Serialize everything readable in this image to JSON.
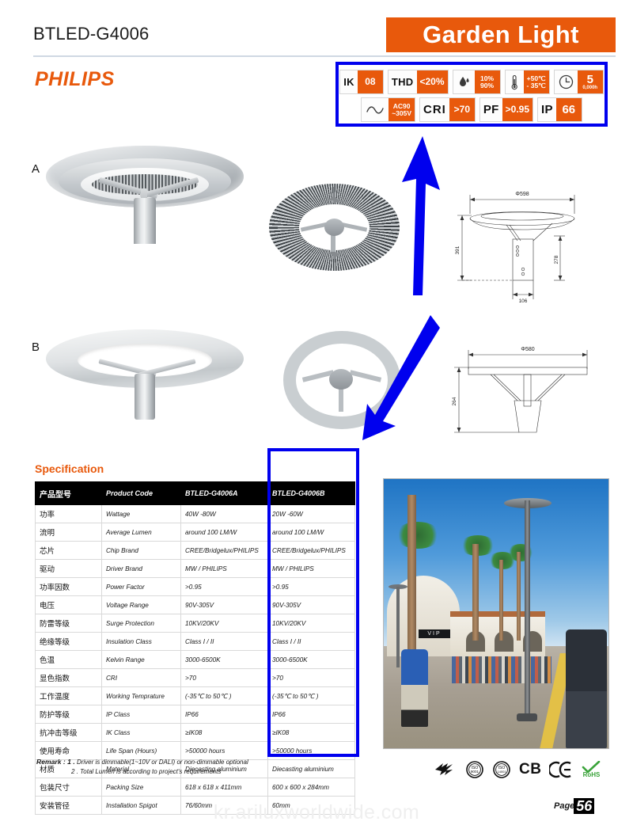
{
  "header": {
    "model_code": "BTLED-G4006",
    "title": "Garden Light",
    "brand": "PHILIPS",
    "accent_color": "#e8590c",
    "highlight_color": "#0000ee"
  },
  "badges": {
    "row1": [
      {
        "label": "IK",
        "value": "08",
        "icon": ""
      },
      {
        "label": "THD",
        "value": "<20%",
        "icon": ""
      },
      {
        "label": "",
        "value": "10%\n90%",
        "icon": "water-drop-icon",
        "value_top": "10%",
        "value_bottom": "90%"
      },
      {
        "label": "",
        "value": "+50℃\n- 35℃",
        "icon": "thermometer-icon",
        "value_top": "+50℃",
        "value_bottom": "- 35℃"
      },
      {
        "label": "",
        "value": "5",
        "icon": "clock-icon",
        "value_big": "5",
        "value_tiny": "0,000h"
      }
    ],
    "row2": [
      {
        "label": "",
        "value": "AC90\n~305V",
        "icon": "ac-wave-icon",
        "value_top": "AC90",
        "value_bottom": "~305V"
      },
      {
        "label": "CRI",
        "value": ">70",
        "icon": ""
      },
      {
        "label": "PF",
        "value": ">0.95",
        "icon": ""
      },
      {
        "label": "IP",
        "value": "66",
        "icon": ""
      }
    ]
  },
  "products": {
    "label_a": "A",
    "label_b": "B"
  },
  "drawings": {
    "a": {
      "diameter": "Φ598",
      "total_height": "391",
      "body_height": "278",
      "spigot_width": "106"
    },
    "b": {
      "diameter": "Φ580",
      "total_height": "264"
    }
  },
  "specification": {
    "heading": "Specification",
    "columns": [
      "产品型号",
      "Product Code",
      "BTLED-G4006A",
      "BTLED-G4006B"
    ],
    "rows": [
      {
        "cn": "功率",
        "en": "Wattage",
        "a": "40W -80W",
        "b": "20W -60W"
      },
      {
        "cn": "流明",
        "en": "Average Lumen",
        "a": "around 100 LM/W",
        "b": "around 100 LM/W"
      },
      {
        "cn": "芯片",
        "en": "Chip Brand",
        "a": "CREE/Bridgelux/PHILIPS",
        "b": "CREE/Bridgelux/PHILIPS"
      },
      {
        "cn": "驱动",
        "en": "Driver Brand",
        "a": "MW / PHILIPS",
        "b": "MW / PHILIPS"
      },
      {
        "cn": "功率因数",
        "en": "Power Factor",
        "a": ">0.95",
        "b": ">0.95"
      },
      {
        "cn": "电压",
        "en": "Voltage Range",
        "a": "90V-305V",
        "b": "90V-305V"
      },
      {
        "cn": "防雷等级",
        "en": "Surge Protection",
        "a": "10KV/20KV",
        "b": "10KV/20KV"
      },
      {
        "cn": "绝缘等级",
        "en": "Insulation Class",
        "a": "Class I / II",
        "b": "Class I / II"
      },
      {
        "cn": "色温",
        "en": "Kelvin Range",
        "a": "3000-6500K",
        "b": "3000-6500K"
      },
      {
        "cn": "显色指数",
        "en": "CRI",
        "a": ">70",
        "b": ">70"
      },
      {
        "cn": "工作温度",
        "en": "Working Temprature",
        "a": "(-35℃ to 50℃ )",
        "b": "(-35℃ to 50℃ )"
      },
      {
        "cn": "防护等级",
        "en": "IP Class",
        "a": "IP66",
        "b": "IP66"
      },
      {
        "cn": "抗冲击等级",
        "en": "IK  Class",
        "a": "≥IK08",
        "b": "≥IK08"
      },
      {
        "cn": "使用寿命",
        "en": "Life Span (Hours)",
        "a": ">50000 hours",
        "b": ">50000 hours"
      },
      {
        "cn": "材质",
        "en": "Material",
        "a": "Diecasting aluminium",
        "b": "Diecasting aluminium"
      },
      {
        "cn": "包装尺寸",
        "en": "Packing Size",
        "a": "618 x 618 x 411mm",
        "b": "600 x 600 x 284mm"
      },
      {
        "cn": "安装管径",
        "en": "Installation Spigot",
        "a": "76/60mm",
        "b": "60mm"
      }
    ]
  },
  "remark": {
    "title": "Remark : 1 .",
    "line1": " Driver is dimmable(1~10V or DALI) or non-dimmable optional",
    "line2": "2 . Total Lumen is according to project's requirements"
  },
  "photo": {
    "sign_text": "VIP"
  },
  "certifications": [
    {
      "name": "ccc-mark-icon",
      "text": ""
    },
    {
      "name": "iso-9001-icon",
      "text": "ISO 9001"
    },
    {
      "name": "iso-14001-icon",
      "text": "ISO 14001"
    },
    {
      "name": "cb-mark",
      "text": "CB"
    },
    {
      "name": "ce-mark",
      "text": "CE"
    },
    {
      "name": "rohs-mark",
      "text": "RoHS"
    }
  ],
  "footer": {
    "page_word": "Page",
    "page_number": "56",
    "watermark": "kr.ariluxworldwide.com"
  }
}
